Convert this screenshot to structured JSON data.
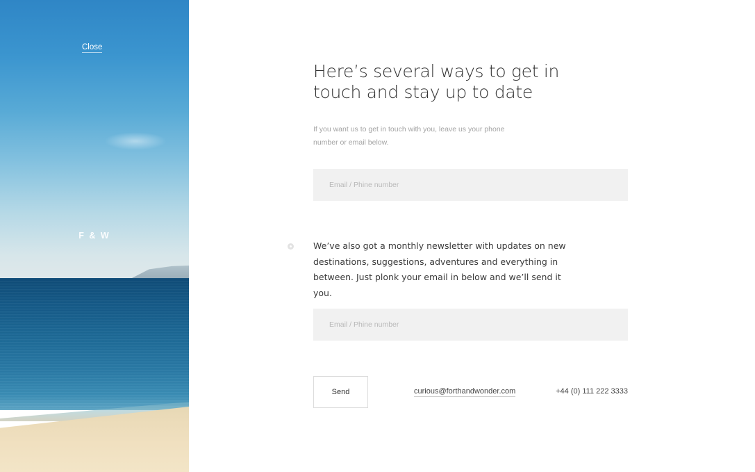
{
  "sidebar": {
    "close_label": "Close",
    "brand": "F & W"
  },
  "contact": {
    "headline": "Here’s several ways to get in touch and stay up to date",
    "intro": "If you want us to get in touch with you, leave us your phone number or email below.",
    "contact_field_placeholder": "Email / Phine number"
  },
  "newsletter": {
    "text": "We’ve also got a monthly newsletter with updates on new destinations, suggestions, adventures and everything in between. Just plonk your email in below and we’ll send it you.",
    "field_placeholder": "Email / Phine number"
  },
  "footer": {
    "send_label": "Send",
    "email": "curious@forthandwonder.com",
    "phone": "+44 (0) 111 222 3333"
  },
  "colors": {
    "field_background": "#f1f1f1",
    "headline_text": "#333333",
    "muted_text": "#a4a4a4"
  }
}
